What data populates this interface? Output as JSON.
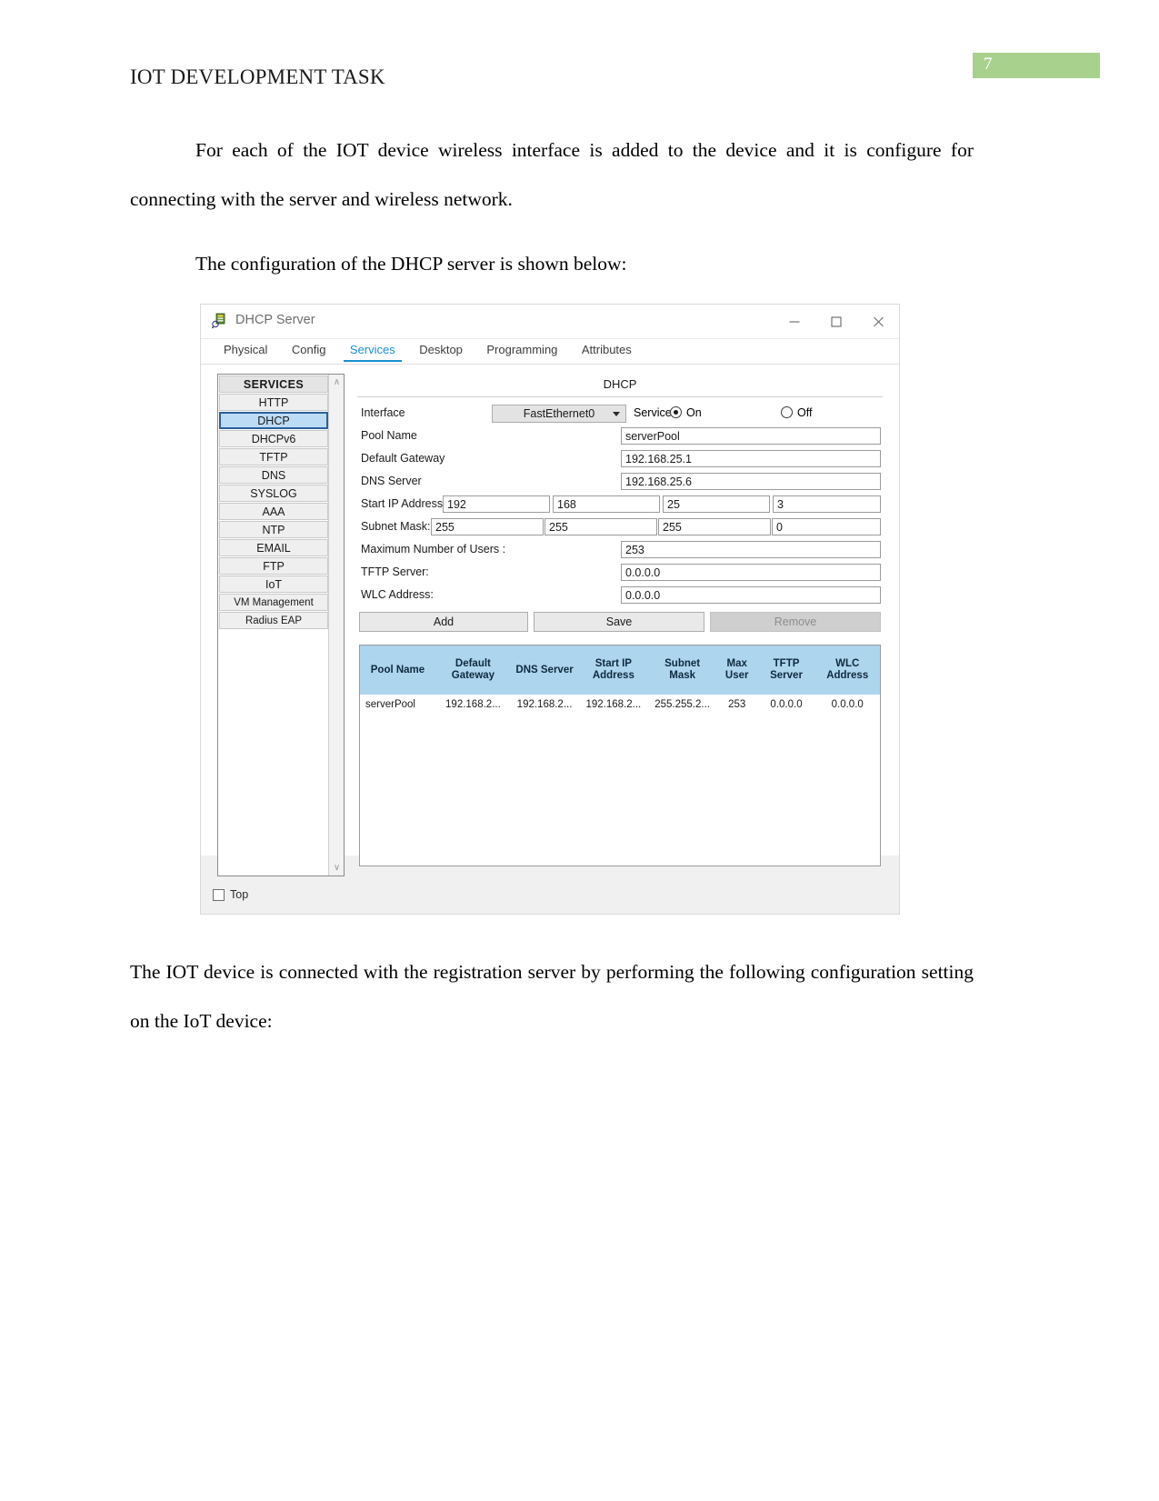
{
  "document": {
    "header_title": "IOT DEVELOPMENT TASK",
    "page_number": "7",
    "page_number_bg": "#a9d18e",
    "paragraphs": {
      "p1": "For each of the IOT device wireless interface is added to the device and it is configure for connecting with the server and wireless network.",
      "p2": "The configuration of the DHCP server is shown below:",
      "p3": "The IOT device is connected with the registration server by performing the following configuration setting on the IoT device:"
    }
  },
  "window": {
    "title": "DHCP Server",
    "icon": "packet-tracer-server-icon",
    "controls": {
      "minimize": "minimize-icon",
      "maximize": "maximize-icon",
      "close": "close-icon"
    },
    "tabs": [
      {
        "label": "Physical",
        "active": false
      },
      {
        "label": "Config",
        "active": false
      },
      {
        "label": "Services",
        "active": true
      },
      {
        "label": "Desktop",
        "active": false
      },
      {
        "label": "Programming",
        "active": false
      },
      {
        "label": "Attributes",
        "active": false
      }
    ],
    "active_tab_color": "#1a8fd1"
  },
  "sidebar": {
    "header": "SERVICES",
    "selected": "DHCP",
    "selected_bg": "#bcdcf5",
    "items": [
      {
        "label": "HTTP"
      },
      {
        "label": "DHCP"
      },
      {
        "label": "DHCPv6"
      },
      {
        "label": "TFTP"
      },
      {
        "label": "DNS"
      },
      {
        "label": "SYSLOG"
      },
      {
        "label": "AAA"
      },
      {
        "label": "NTP"
      },
      {
        "label": "EMAIL"
      },
      {
        "label": "FTP"
      },
      {
        "label": "IoT"
      },
      {
        "label": "VM Management"
      },
      {
        "label": "Radius EAP"
      }
    ]
  },
  "panel": {
    "title": "DHCP",
    "interface": {
      "label": "Interface",
      "value": "FastEthernet0"
    },
    "service": {
      "label": "Service",
      "on_label": "On",
      "off_label": "Off",
      "selected": "On"
    },
    "fields": {
      "pool_name": {
        "label": "Pool Name",
        "value": "serverPool"
      },
      "default_gateway": {
        "label": "Default Gateway",
        "value": "192.168.25.1"
      },
      "dns_server": {
        "label": "DNS Server",
        "value": "192.168.25.6"
      },
      "start_ip": {
        "label": "Start IP Address :",
        "octets": [
          "192",
          "168",
          "25",
          "3"
        ]
      },
      "subnet_mask": {
        "label": "Subnet Mask:",
        "octets": [
          "255",
          "255",
          "255",
          "0"
        ]
      },
      "max_users": {
        "label": "Maximum Number of Users :",
        "value": "253"
      },
      "tftp_server": {
        "label": "TFTP Server:",
        "value": "0.0.0.0"
      },
      "wlc_address": {
        "label": "WLC Address:",
        "value": "0.0.0.0"
      }
    },
    "buttons": {
      "add": "Add",
      "save": "Save",
      "remove": "Remove",
      "remove_disabled": true
    },
    "table": {
      "header_bg": "#aed5ee",
      "columns": [
        "Pool Name",
        "Default Gateway",
        "DNS Server",
        "Start IP Address",
        "Subnet Mask",
        "Max User",
        "TFTP Server",
        "WLC Address"
      ],
      "rows": [
        {
          "pool_name": "serverPool",
          "default_gateway": "192.168.2...",
          "dns_server": "192.168.2...",
          "start_ip": "192.168.2...",
          "subnet_mask": "255.255.2...",
          "max_user": "253",
          "tftp_server": "0.0.0.0",
          "wlc_address": "0.0.0.0"
        }
      ]
    }
  },
  "bottom": {
    "top_checkbox_label": "Top",
    "top_checkbox_checked": false
  }
}
